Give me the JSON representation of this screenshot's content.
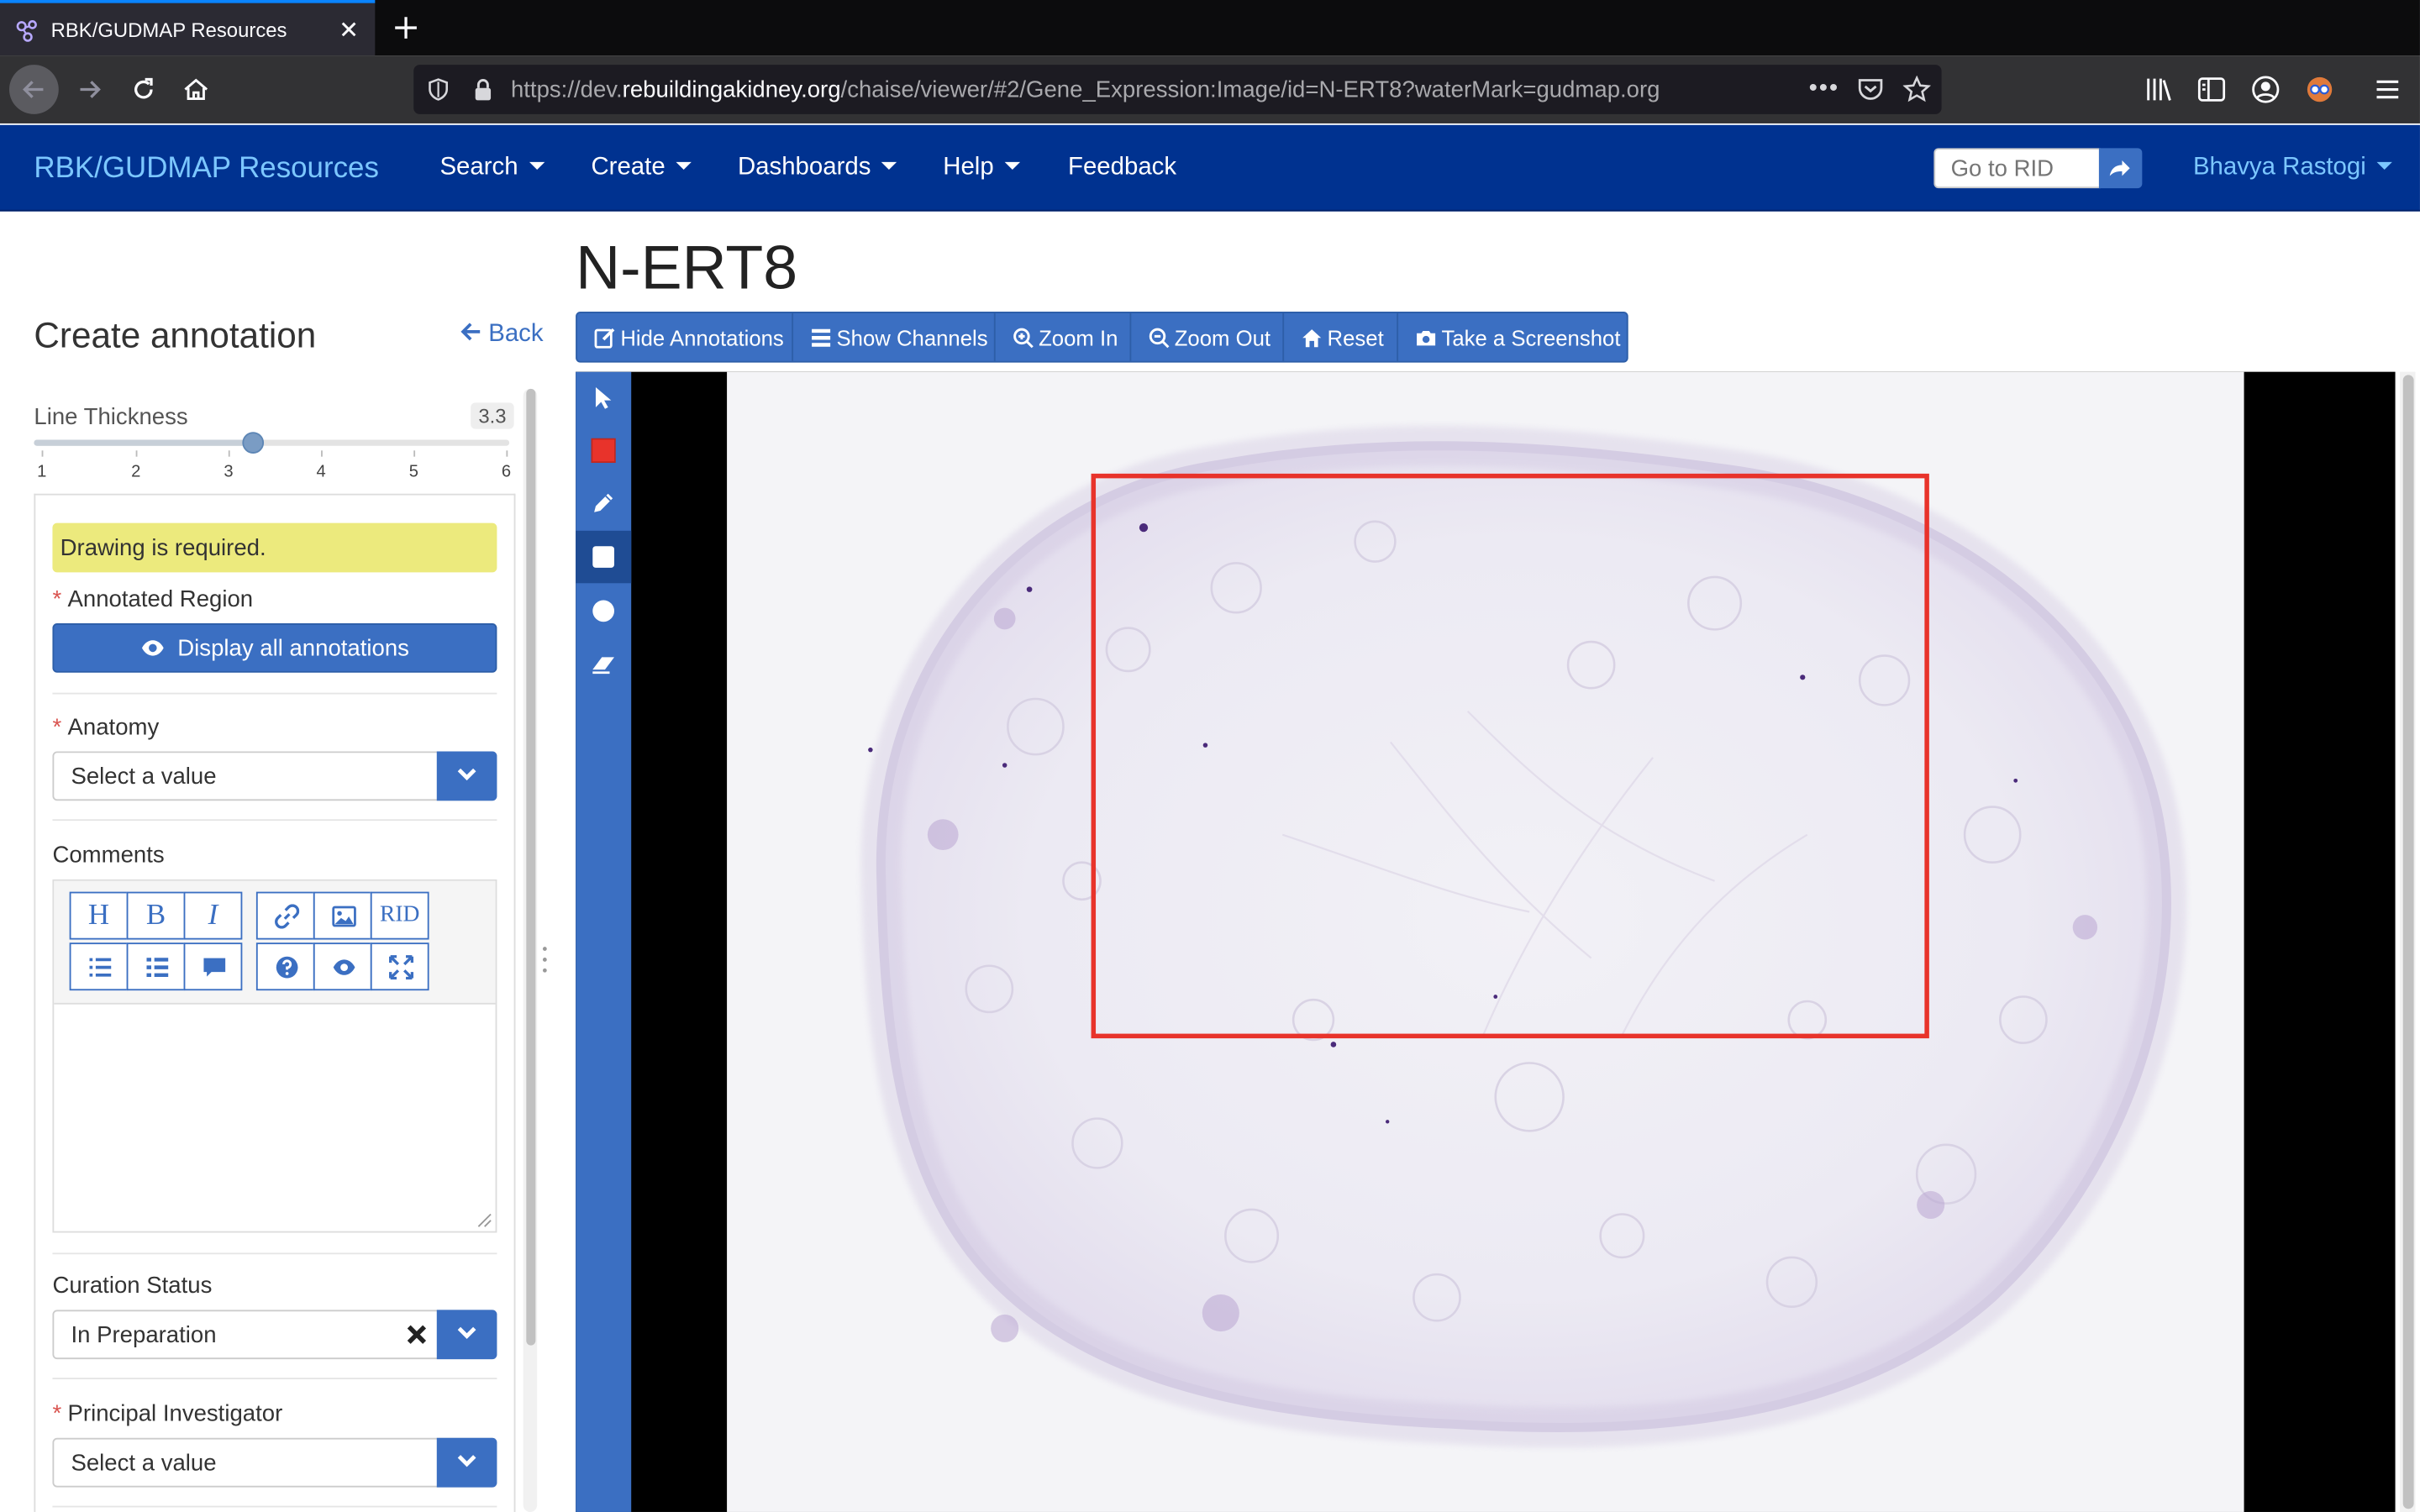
{
  "browser": {
    "tab_title": "RBK/GUDMAP Resources",
    "url_prefix": "https://dev.",
    "url_host": "rebuildingakidney.org",
    "url_path": "/chaise/viewer/#2/Gene_Expression:Image/id=N-ERT8?waterMark=gudmap.org",
    "url_more": "•••"
  },
  "app": {
    "brand": "RBK/GUDMAP Resources",
    "menu": [
      "Search",
      "Create",
      "Dashboards",
      "Help",
      "Feedback"
    ],
    "rid_placeholder": "Go to RID",
    "user": "Bhavya Rastogi"
  },
  "panel": {
    "title": "Create annotation",
    "back": "Back",
    "line_thickness_label": "Line Thickness",
    "line_thickness_value": "3.3",
    "line_thickness_fraction": 0.46,
    "slider_ticks": [
      "1",
      "2",
      "3",
      "4",
      "5",
      "6"
    ],
    "drawing_required": "Drawing is required.",
    "annotated_region_label": "Annotated Region",
    "display_all_button": "Display all annotations",
    "anatomy_label": "Anatomy",
    "anatomy_value": "Select a value",
    "comments_label": "Comments",
    "editor_buttons": [
      "H",
      "B",
      "I",
      "RID"
    ],
    "curation_status_label": "Curation Status",
    "curation_status_value": "In Preparation",
    "pi_label": "Principal Investigator",
    "pi_value": "Select a value",
    "required_mark": "*"
  },
  "viewer": {
    "title": "N-ERT8",
    "toolbar": [
      "Hide Annotations",
      "Show Channels",
      "Zoom In",
      "Zoom Out",
      "Reset",
      "Take a Screenshot"
    ],
    "annotation_color": "#e8332b",
    "tools": [
      "pointer-icon",
      "color-swatch-icon",
      "pencil-icon",
      "rectangle-icon",
      "circle-icon",
      "eraser-icon"
    ]
  },
  "colors": {
    "nav_bg": "#003290",
    "brand": "#7cc7ff",
    "primary": "#3b6fc2",
    "alert_bg": "#ecea7d"
  }
}
